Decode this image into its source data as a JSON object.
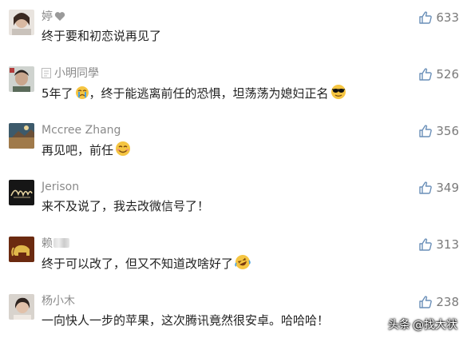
{
  "comments": [
    {
      "user": "婷",
      "text": "终于要和初恋说再见了",
      "likes": "633",
      "emoji": null
    },
    {
      "user": "小明同學",
      "text": "5年了",
      "text2": "，终于能逃离前任的恐惧，坦荡荡为媳妇正名",
      "likes": "526",
      "emoji": "sunglasses-emoji"
    },
    {
      "user": "Mccree Zhang",
      "text": "再见吧，前任",
      "likes": "356",
      "emoji": "smile-emoji"
    },
    {
      "user": "Jerison",
      "text": "来不及说了，我去改微信号了！",
      "likes": "349",
      "emoji": null
    },
    {
      "user": "赖",
      "text": "终于可以改了，但又不知道改啥好了",
      "likes": "313",
      "emoji": "laugh-cry-emoji"
    },
    {
      "user": "杨小木",
      "text": "一向快人一步的苹果，这次腾讯竟然很安卓。哈哈哈！",
      "likes": "238",
      "emoji": null
    }
  ],
  "watermark": {
    "prefix": "头条",
    "handle": "@找大状"
  },
  "colors": {
    "name": "#8a8a8a",
    "text": "#222222",
    "likes": "#7a7a7a",
    "background": "#ffffff"
  }
}
